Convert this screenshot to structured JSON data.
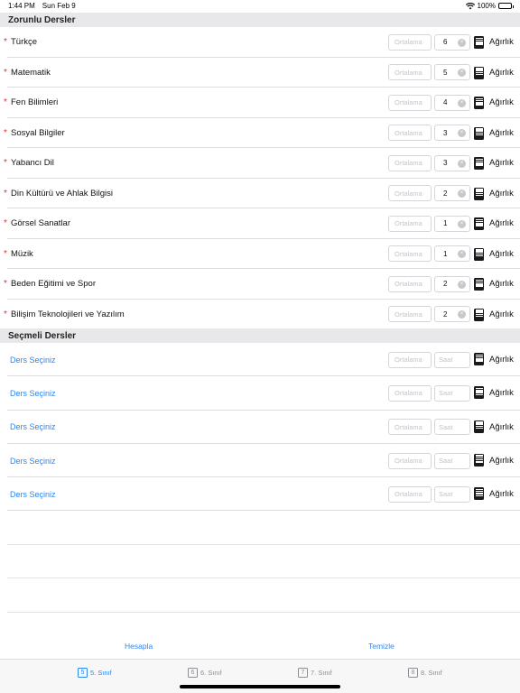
{
  "status": {
    "time": "1:44 PM",
    "date": "Sun Feb 9",
    "battery": "100%"
  },
  "required": {
    "title": "Zorunlu Dersler",
    "average_placeholder": "Ortalama",
    "weight_label": "Ağırlık",
    "subjects": [
      {
        "name": "Türkçe",
        "hours": "6"
      },
      {
        "name": "Matematik",
        "hours": "5"
      },
      {
        "name": "Fen Bilimleri",
        "hours": "4"
      },
      {
        "name": "Sosyal Bilgiler",
        "hours": "3"
      },
      {
        "name": "Yabancı Dil",
        "hours": "3"
      },
      {
        "name": "Din Kültürü ve Ahlak Bilgisi",
        "hours": "2"
      },
      {
        "name": "Görsel Sanatlar",
        "hours": "1"
      },
      {
        "name": "Müzik",
        "hours": "1"
      },
      {
        "name": "Beden Eğitimi ve Spor",
        "hours": "2"
      },
      {
        "name": "Bilişim Teknolojileri ve Yazılım",
        "hours": "2"
      }
    ]
  },
  "elective": {
    "title": "Seçmeli Dersler",
    "select_label": "Ders Seçiniz",
    "average_placeholder": "Ortalama",
    "hours_placeholder": "Saat",
    "weight_label": "Ağırlık",
    "count": 5
  },
  "actions": {
    "calculate": "Hesapla",
    "clear": "Temizle"
  },
  "tabs": [
    {
      "icon": "5",
      "label": "5. Sınıf",
      "active": true
    },
    {
      "icon": "6",
      "label": "6. Sınıf",
      "active": false
    },
    {
      "icon": "7",
      "label": "7. Sınıf",
      "active": false
    },
    {
      "icon": "8",
      "label": "8. Sınıf",
      "active": false
    }
  ],
  "colors": {
    "accent": "#2f86ef",
    "required_mark": "#e0312a",
    "header_bg": "#e8e8ea"
  }
}
